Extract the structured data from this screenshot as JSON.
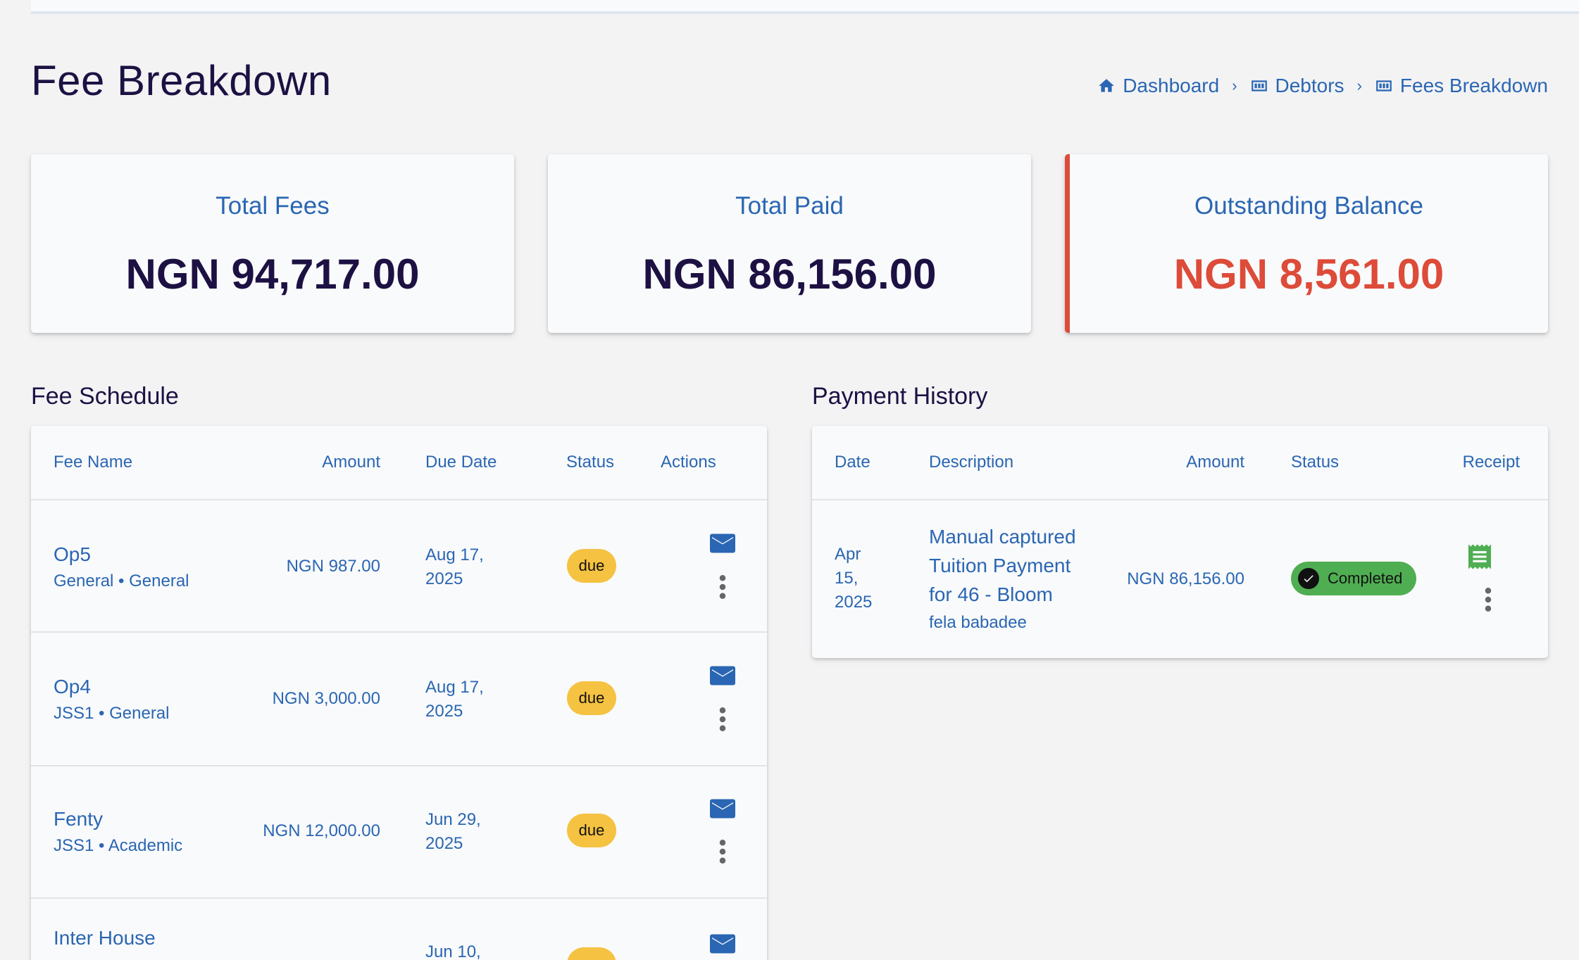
{
  "page": {
    "title": "Fee Breakdown"
  },
  "breadcrumb": [
    {
      "label": "Dashboard",
      "icon": "home-icon"
    },
    {
      "label": "Debtors",
      "icon": "grid-icon"
    },
    {
      "label": "Fees Breakdown",
      "icon": "grid-icon"
    }
  ],
  "summary": {
    "total_fees": {
      "label": "Total Fees",
      "value": "NGN 94,717.00"
    },
    "total_paid": {
      "label": "Total Paid",
      "value": "NGN 86,156.00"
    },
    "outstanding": {
      "label": "Outstanding Balance",
      "value": "NGN 8,561.00",
      "color": "#dd4b39"
    }
  },
  "fee_schedule": {
    "title": "Fee Schedule",
    "headers": {
      "name": "Fee Name",
      "amount": "Amount",
      "due": "Due Date",
      "status": "Status",
      "actions": "Actions"
    },
    "rows": [
      {
        "name": "Op5",
        "sub": "General • General",
        "amount": "NGN 987.00",
        "due1": "Aug 17,",
        "due2": "2025",
        "status": "due"
      },
      {
        "name": "Op4",
        "sub": "JSS1 • General",
        "amount": "NGN 3,000.00",
        "due1": "Aug 17,",
        "due2": "2025",
        "status": "due"
      },
      {
        "name": "Fenty",
        "sub": "JSS1 • Academic",
        "amount": "NGN 12,000.00",
        "due1": "Jun 29,",
        "due2": "2025",
        "status": "due"
      },
      {
        "name": "Inter House",
        "sub": "",
        "amount": "",
        "due1": "Jun 10,",
        "due2": "",
        "status": ""
      }
    ]
  },
  "payment_history": {
    "title": "Payment History",
    "headers": {
      "date": "Date",
      "description": "Description",
      "amount": "Amount",
      "status": "Status",
      "receipt": "Receipt"
    },
    "rows": [
      {
        "date1": "Apr",
        "date2": "15,",
        "date3": "2025",
        "desc1": "Manual captured",
        "desc2": "Tuition Payment",
        "desc3": "for 46 - Bloom",
        "payer": "fela babadee",
        "amount": "NGN 86,156.00",
        "status": "Completed"
      }
    ]
  },
  "colors": {
    "accent": "#2a66b3",
    "due_badge": "#f5c242",
    "completed_badge": "#4fae52",
    "title": "#1d1143"
  }
}
